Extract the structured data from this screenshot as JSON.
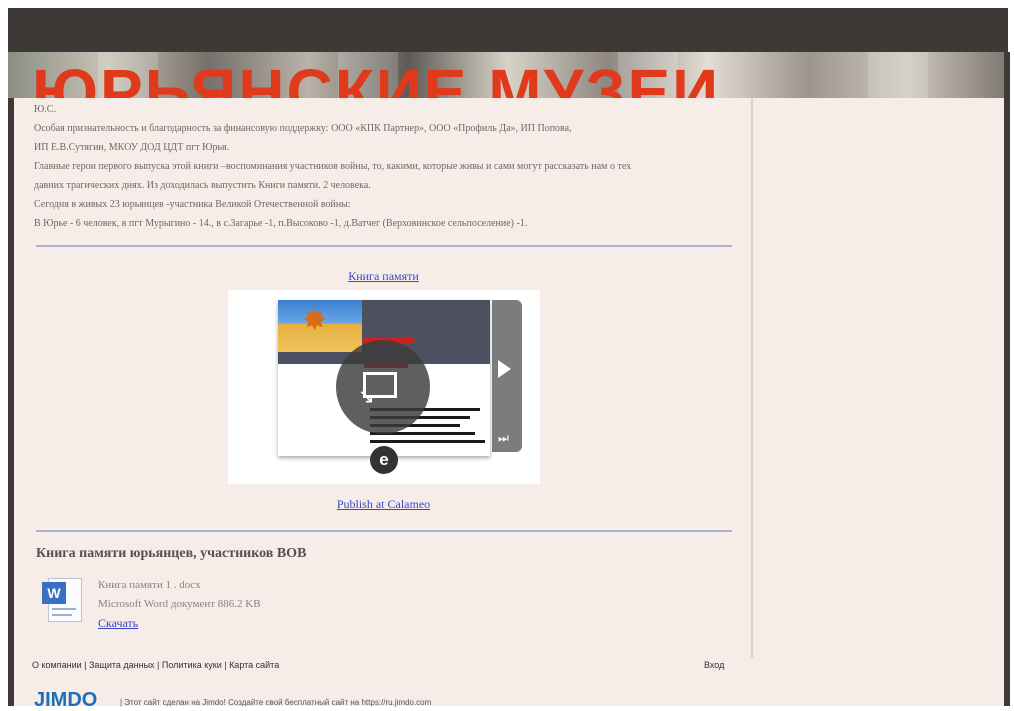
{
  "banner": {
    "title": "ЮРЬЯНСКИЕ МУЗЕИ"
  },
  "intro": {
    "lines": [
      "Ю.С.",
      "Особая признательность и благодарность за финансовую поддержку: ООО «КПК Партнер», ООО «Профиль Да», ИП Попова,",
      "ИП Е.В.Сутягин, МКОУ ДОД ЦДТ пгт Юрья.",
      "Главные герои первого выпуска этой книги –воспоминания участников войны, то, какими, которые живы и сами могут рассказать нам о тех",
      "давних трагических днях. Из доходилась выпустить Книги памяти. 2 человека.",
      "Сегодня в живых 23 юрьянцев -участника Великой Отечественной войны:",
      "В Юрье - 6 человек, в пгт Мурыгино - 14., в с.Загарье -1, п.Высоково -1, д.Ватчег (Верховинское сельпоселение) -1."
    ]
  },
  "book_link": "Книга памяти",
  "publish_link": "Publish at Calameo",
  "viewer": {
    "logo": "e",
    "skip_glyph": "⏭"
  },
  "section": {
    "title": "Книга памяти юрьянцев, участников ВОВ"
  },
  "file": {
    "name": "Книга памяти 1 . docx",
    "type": "Microsoft Word документ 886.2 KB",
    "download": "Скачать",
    "icon_letter": "W"
  },
  "footer": {
    "links": "О компании | Защита данных | Политика куки | Карта сайта",
    "login": "Вход"
  },
  "jimdo": {
    "logo": "JIMDO",
    "text": "| Этот сайт сделан на Jimdo! Создайте свой бесплатный сайт на https://ru.jimdo.com"
  },
  "colors": {
    "banner_title": "#e03a1c",
    "frame": "#3e3936",
    "content_bg": "#f6ece8",
    "link": "#3a48c8",
    "rule": "#aab0d8"
  }
}
